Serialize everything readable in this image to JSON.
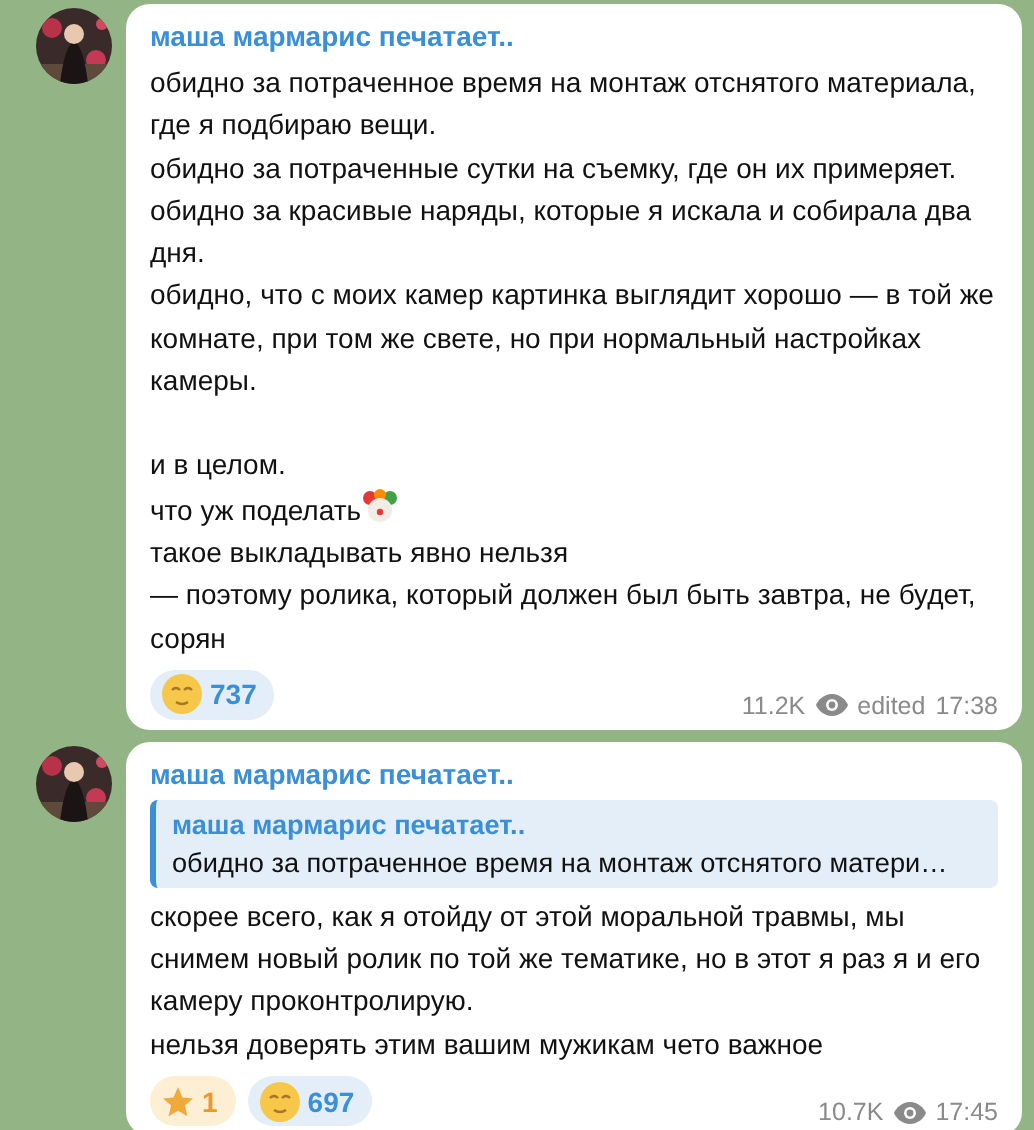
{
  "messages": [
    {
      "author": "маша мармарис печатает..",
      "paragraphs": [
        {
          "text": "обидно за потраченное время на монтаж отснятого материала, где я подбираю вещи.",
          "emoji": false
        },
        {
          "text": "обидно за потраченные сутки на съемку, где он их примеряет.",
          "emoji": false
        },
        {
          "text": "обидно за красивые наряды, которые я искала и собирала два дня.",
          "emoji": false
        },
        {
          "text": "обидно, что с моих камер картинка выглядит хорошо — в той же комнате, при том же свете, но при нормальный настройках камеры.",
          "emoji": false,
          "gap_after": true
        },
        {
          "text": "и в целом.",
          "emoji": false
        },
        {
          "text": "что уж поделать",
          "emoji": true
        },
        {
          "text": "такое выкладывать явно нельзя",
          "emoji": false
        },
        {
          "text": "— поэтому ролика, который должен был быть завтра, не будет, сорян",
          "emoji": false
        }
      ],
      "reactions": [
        {
          "kind": "emoji",
          "count": "737"
        }
      ],
      "views": "11.2K",
      "edited": "edited",
      "time": "17:38"
    },
    {
      "author": "маша мармарис печатает..",
      "reply": {
        "author": "маша мармарис печатает..",
        "text": "обидно за потраченное время на монтаж отснятого матери…"
      },
      "paragraphs": [
        {
          "text": "скорее всего, как я отойду от этой моральной травмы, мы снимем новый ролик по той же тематике, но в этот я раз я и его камеру проконтролирую.",
          "emoji": false
        },
        {
          "text": "нельзя доверять этим вашим мужикам чето важное",
          "emoji": false
        }
      ],
      "reactions": [
        {
          "kind": "star",
          "count": "1"
        },
        {
          "kind": "emoji",
          "count": "697"
        }
      ],
      "views": "10.7K",
      "time": "17:45"
    }
  ]
}
